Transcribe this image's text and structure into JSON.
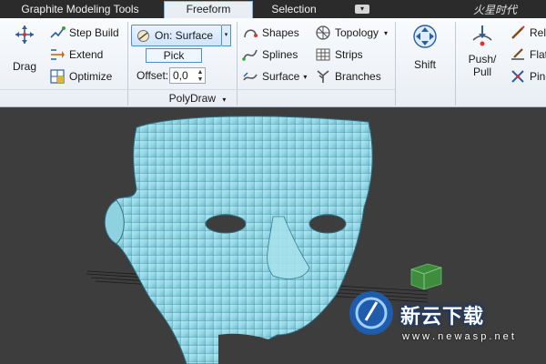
{
  "tabs": {
    "title": "Graphite Modeling Tools",
    "freeform": "Freeform",
    "selection": "Selection",
    "menu_glyph": "▾"
  },
  "logo_top": "火星时代",
  "ribbon": {
    "drag": "Drag",
    "step_build": "Step Build",
    "extend": "Extend",
    "optimize": "Optimize",
    "on_surface": "On: Surface",
    "pick": "Pick",
    "offset_label": "Offset:",
    "offset_value": "0,0",
    "shapes": "Shapes",
    "splines": "Splines",
    "surface": "Surface",
    "topology": "Topology",
    "strips": "Strips",
    "branches": "Branches",
    "shift": "Shift",
    "push_pull_1": "Push/",
    "push_pull_2": "Pull",
    "relax": "Rela",
    "flatten": "Flat",
    "pinch": "Pinc",
    "panel_name": "PolyDraw",
    "panel_glyph": "▾",
    "dropdown_glyph": "▾"
  },
  "watermark": {
    "name": "新云下载",
    "url": "w w w . n e w a s p . n e t"
  },
  "colors": {
    "mesh": "#9fe0ec",
    "wire": "#2e6f86",
    "ribbon_bg": "#eef2f7",
    "accent": "#4a8fd6",
    "viewport": "#3d3d3d"
  }
}
